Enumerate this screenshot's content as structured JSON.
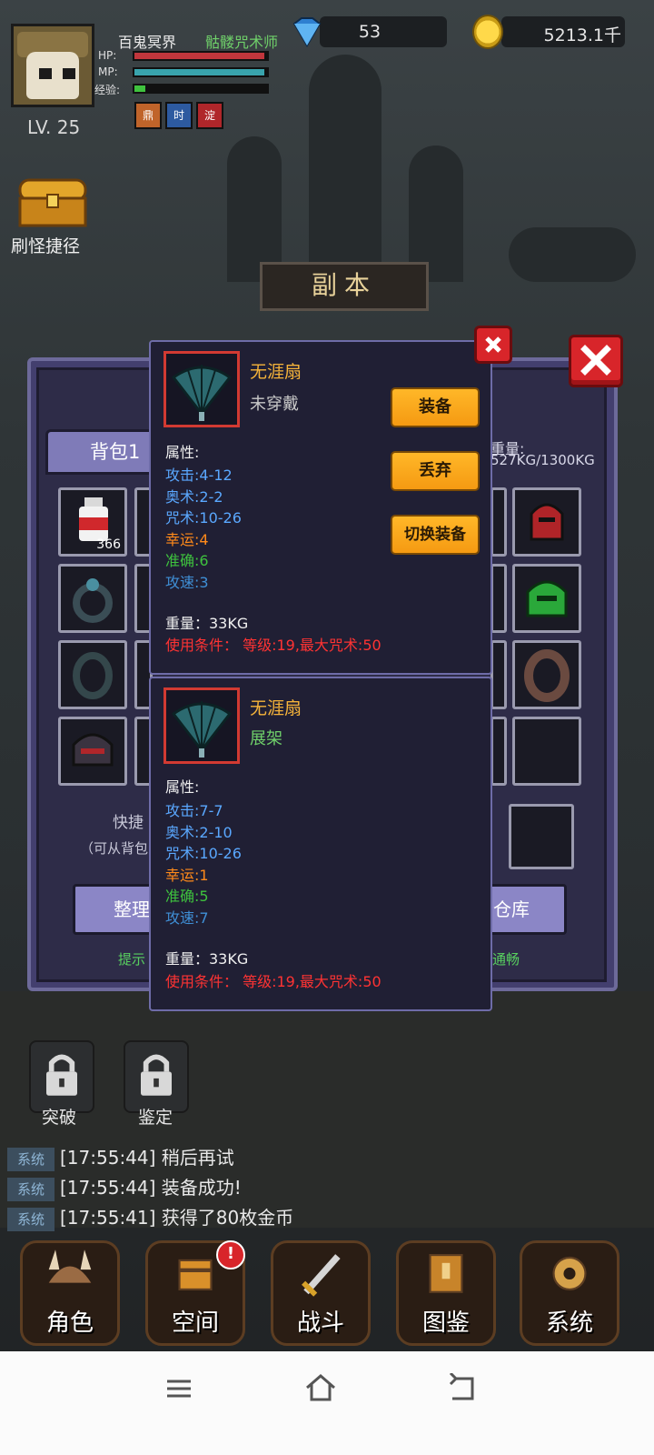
{
  "player": {
    "name": "百鬼冥界",
    "class": "骷髅咒术师",
    "level": "LV. 25",
    "hp_label": "HP:",
    "mp_label": "MP:",
    "exp_label": "经验:",
    "hp_fraction": 0.98,
    "mp_fraction": 0.98,
    "exp_fraction": 0.08,
    "buffs": [
      "鼎",
      "时",
      "淀"
    ]
  },
  "currency": {
    "gems": "53",
    "gold": "5213.1千"
  },
  "shortcut": {
    "label": "刷怪捷径"
  },
  "dungeon": {
    "label": "副本"
  },
  "backpack": {
    "tab": "背包1",
    "weight_label": "重量:",
    "weight_value": "527KG/1300KG",
    "potion_count": "366",
    "quick_hint": "快捷",
    "quick_sub": "（可从背包",
    "sort_button": "整理",
    "storage_button": "仓库",
    "hint_left": "提示",
    "hint_right": "通畅"
  },
  "item_current": {
    "name": "无涯扇",
    "status": "未穿戴",
    "attr_title": "属性:",
    "attrs": [
      {
        "text": "攻击:4-12",
        "color": "#5aa8ff"
      },
      {
        "text": "奥术:2-2",
        "color": "#5aa8ff"
      },
      {
        "text": "咒术:10-26",
        "color": "#5aa8ff"
      },
      {
        "text": "幸运:4",
        "color": "#ff8a1a"
      },
      {
        "text": "准确:6",
        "color": "#3ec23e"
      },
      {
        "text": "攻速:3",
        "color": "#3f8fd6"
      }
    ],
    "weight": "重量：33KG",
    "requirement": "使用条件：  等级:19,最大咒术:50",
    "buttons": [
      "装备",
      "丢弃",
      "切换装备"
    ]
  },
  "item_displayed": {
    "name": "无涯扇",
    "status": "展架",
    "attr_title": "属性:",
    "attrs": [
      {
        "text": "攻击:7-7",
        "color": "#5aa8ff"
      },
      {
        "text": "奥术:2-10",
        "color": "#5aa8ff"
      },
      {
        "text": "咒术:10-26",
        "color": "#5aa8ff"
      },
      {
        "text": "幸运:1",
        "color": "#ff8a1a"
      },
      {
        "text": "准确:5",
        "color": "#3ec23e"
      },
      {
        "text": "攻速:7",
        "color": "#3f8fd6"
      }
    ],
    "weight": "重量：33KG",
    "requirement": "使用条件：  等级:19,最大咒术:50"
  },
  "locked_features": [
    "突破",
    "鉴定"
  ],
  "log": [
    {
      "tag": "系统",
      "text": "[17:55:44] 稍后再试"
    },
    {
      "tag": "系统",
      "text": "[17:55:44] 装备成功!"
    },
    {
      "tag": "系统",
      "text": "[17:55:41] 获得了80枚金币"
    }
  ],
  "bottom_nav": [
    "角色",
    "空间",
    "战斗",
    "图鉴",
    "系统"
  ]
}
